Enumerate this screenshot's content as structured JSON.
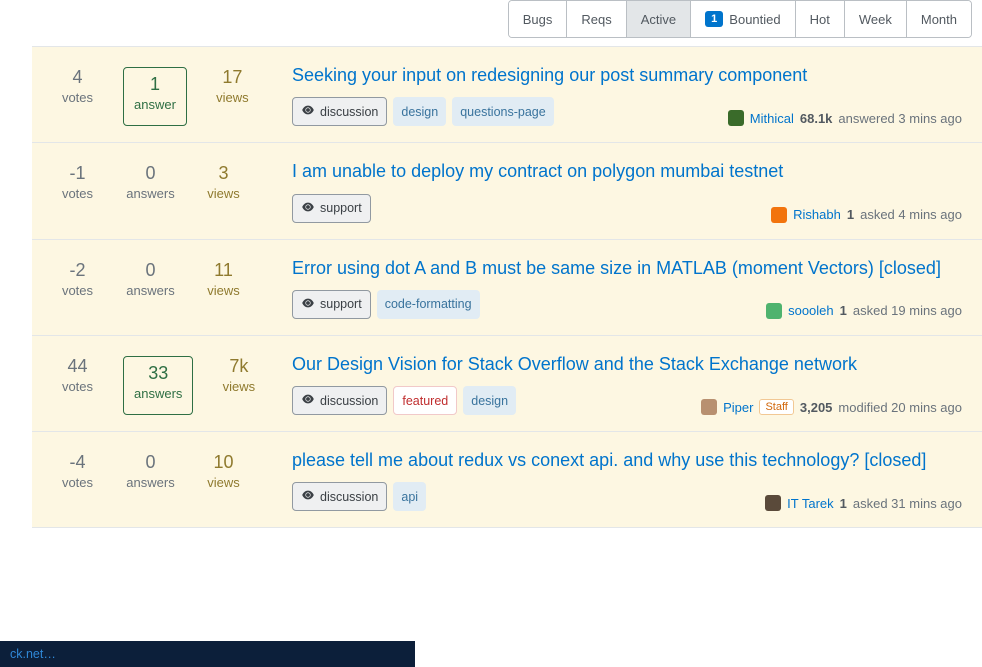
{
  "tabs": [
    {
      "label": "Bugs",
      "active": false,
      "badge": null
    },
    {
      "label": "Reqs",
      "active": false,
      "badge": null
    },
    {
      "label": "Active",
      "active": true,
      "badge": null
    },
    {
      "label": "Bountied",
      "active": false,
      "badge": "1"
    },
    {
      "label": "Hot",
      "active": false,
      "badge": null
    },
    {
      "label": "Week",
      "active": false,
      "badge": null
    },
    {
      "label": "Month",
      "active": false,
      "badge": null
    }
  ],
  "questions": [
    {
      "votes": "4",
      "votes_lbl": "votes",
      "answers": "1",
      "answers_lbl": "answer",
      "has_answer_box": true,
      "views": "17",
      "views_lbl": "views",
      "title": "Seeking your input on redesigning our post summary component",
      "tags": [
        {
          "text": "discussion",
          "style": "req",
          "eye": true
        },
        {
          "text": "design",
          "style": "",
          "eye": false
        },
        {
          "text": "questions-page",
          "style": "",
          "eye": false
        }
      ],
      "user": {
        "name": "Mithical",
        "rep": "68.1k",
        "action": "answered 3 mins ago",
        "avatar_bg": "#3a6b2a",
        "staff": null
      }
    },
    {
      "votes": "-1",
      "votes_lbl": "votes",
      "answers": "0",
      "answers_lbl": "answers",
      "has_answer_box": false,
      "views": "3",
      "views_lbl": "views",
      "title": "I am unable to deploy my contract on polygon mumbai testnet",
      "tags": [
        {
          "text": "support",
          "style": "req",
          "eye": true
        }
      ],
      "user": {
        "name": "Rishabh",
        "rep": "1",
        "action": "asked 4 mins ago",
        "avatar_bg": "#f2740d",
        "staff": null
      }
    },
    {
      "votes": "-2",
      "votes_lbl": "votes",
      "answers": "0",
      "answers_lbl": "answers",
      "has_answer_box": false,
      "views": "11",
      "views_lbl": "views",
      "title": "Error using dot A and B must be same size in MATLAB (moment Vectors) [closed]",
      "tags": [
        {
          "text": "support",
          "style": "req",
          "eye": true
        },
        {
          "text": "code-formatting",
          "style": "",
          "eye": false
        }
      ],
      "user": {
        "name": "soooleh",
        "rep": "1",
        "action": "asked 19 mins ago",
        "avatar_bg": "#4fb36e",
        "staff": null
      }
    },
    {
      "votes": "44",
      "votes_lbl": "votes",
      "answers": "33",
      "answers_lbl": "answers",
      "has_answer_box": true,
      "views": "7k",
      "views_lbl": "views",
      "title": "Our Design Vision for Stack Overflow and the Stack Exchange network",
      "tags": [
        {
          "text": "discussion",
          "style": "req",
          "eye": true
        },
        {
          "text": "featured",
          "style": "featured",
          "eye": false
        },
        {
          "text": "design",
          "style": "",
          "eye": false
        }
      ],
      "user": {
        "name": "Piper",
        "rep": "3,205",
        "action": "modified 20 mins ago",
        "avatar_bg": "#b89070",
        "staff": "Staff"
      }
    },
    {
      "votes": "-4",
      "votes_lbl": "votes",
      "answers": "0",
      "answers_lbl": "answers",
      "has_answer_box": false,
      "views": "10",
      "views_lbl": "views",
      "title": "please tell me about redux vs conext api. and why use this technology? [closed]",
      "tags": [
        {
          "text": "discussion",
          "style": "req",
          "eye": true
        },
        {
          "text": "api",
          "style": "",
          "eye": false
        }
      ],
      "user": {
        "name": "IT Tarek",
        "rep": "1",
        "action": "asked 31 mins ago",
        "avatar_bg": "#5a4a3a",
        "staff": null
      }
    }
  ],
  "status_bar": "ck.net…"
}
